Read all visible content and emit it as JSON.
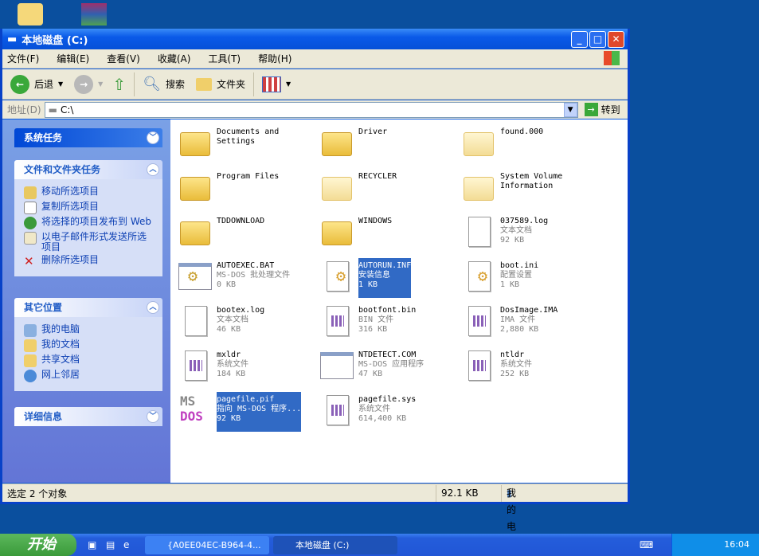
{
  "window": {
    "title": "本地磁盘 (C:)"
  },
  "menu": [
    "文件(F)",
    "编辑(E)",
    "查看(V)",
    "收藏(A)",
    "工具(T)",
    "帮助(H)"
  ],
  "toolbar": {
    "back": "后退",
    "search": "搜索",
    "folders": "文件夹"
  },
  "address": {
    "label": "地址(D)",
    "value": "C:\\",
    "go": "转到"
  },
  "sidebar": {
    "system_tasks": "系统任务",
    "file_tasks": {
      "title": "文件和文件夹任务",
      "items": [
        "移动所选项目",
        "复制所选项目",
        "将选择的项目发布到 Web",
        "以电子邮件形式发送所选项目",
        "删除所选项目"
      ]
    },
    "other_places": {
      "title": "其它位置",
      "items": [
        "我的电脑",
        "我的文档",
        "共享文档",
        "网上邻居"
      ]
    },
    "details": "详细信息"
  },
  "files": [
    {
      "name": "Documents and Settings",
      "type": "folder"
    },
    {
      "name": "Driver",
      "type": "folder"
    },
    {
      "name": "found.000",
      "type": "folder-hidden"
    },
    {
      "name": "Program Files",
      "type": "folder"
    },
    {
      "name": "RECYCLER",
      "type": "folder-hidden"
    },
    {
      "name": "System Volume Information",
      "type": "folder-hidden"
    },
    {
      "name": "TDDOWNLOAD",
      "type": "folder"
    },
    {
      "name": "WINDOWS",
      "type": "folder"
    },
    {
      "name": "037589.log",
      "desc": "文本文档",
      "size": "92 KB",
      "type": "doc"
    },
    {
      "name": "AUTOEXEC.BAT",
      "desc": "MS-DOS 批处理文件",
      "size": "0 KB",
      "type": "gear"
    },
    {
      "name": "AUTORUN.INF",
      "desc": "安装信息",
      "size": "1 KB",
      "type": "gear-doc",
      "selected": true
    },
    {
      "name": "boot.ini",
      "desc": "配置设置",
      "size": "1 KB",
      "type": "gear-doc"
    },
    {
      "name": "bootex.log",
      "desc": "文本文档",
      "size": "46 KB",
      "type": "doc"
    },
    {
      "name": "bootfont.bin",
      "desc": "BIN 文件",
      "size": "316 KB",
      "type": "sys"
    },
    {
      "name": "DosImage.IMA",
      "desc": "IMA 文件",
      "size": "2,880 KB",
      "type": "sys"
    },
    {
      "name": "ntldr",
      "desc": "系统文件",
      "size": "184 KB",
      "type": "sys",
      "display": "mxldr"
    },
    {
      "name": "NTDETECT.COM",
      "desc": "MS-DOS 应用程序",
      "size": "47 KB",
      "type": "app"
    },
    {
      "name": "ntldr",
      "desc": "系统文件",
      "size": "252 KB",
      "type": "sys"
    },
    {
      "name": "pagefile.pif",
      "desc": "指向 MS-DOS 程序...",
      "size": "92 KB",
      "type": "msdos",
      "selected": true
    },
    {
      "name": "pagefile.sys",
      "desc": "系统文件",
      "size": "614,400 KB",
      "type": "sys"
    }
  ],
  "status": {
    "selection": "选定 2 个对象",
    "size": "92.1 KB",
    "location": "我的电脑"
  },
  "taskbar": {
    "start": "开始",
    "tasks": [
      "{A0EE04EC-B964-4...",
      "本地磁盘 (C:)"
    ],
    "clock": "16:04"
  }
}
